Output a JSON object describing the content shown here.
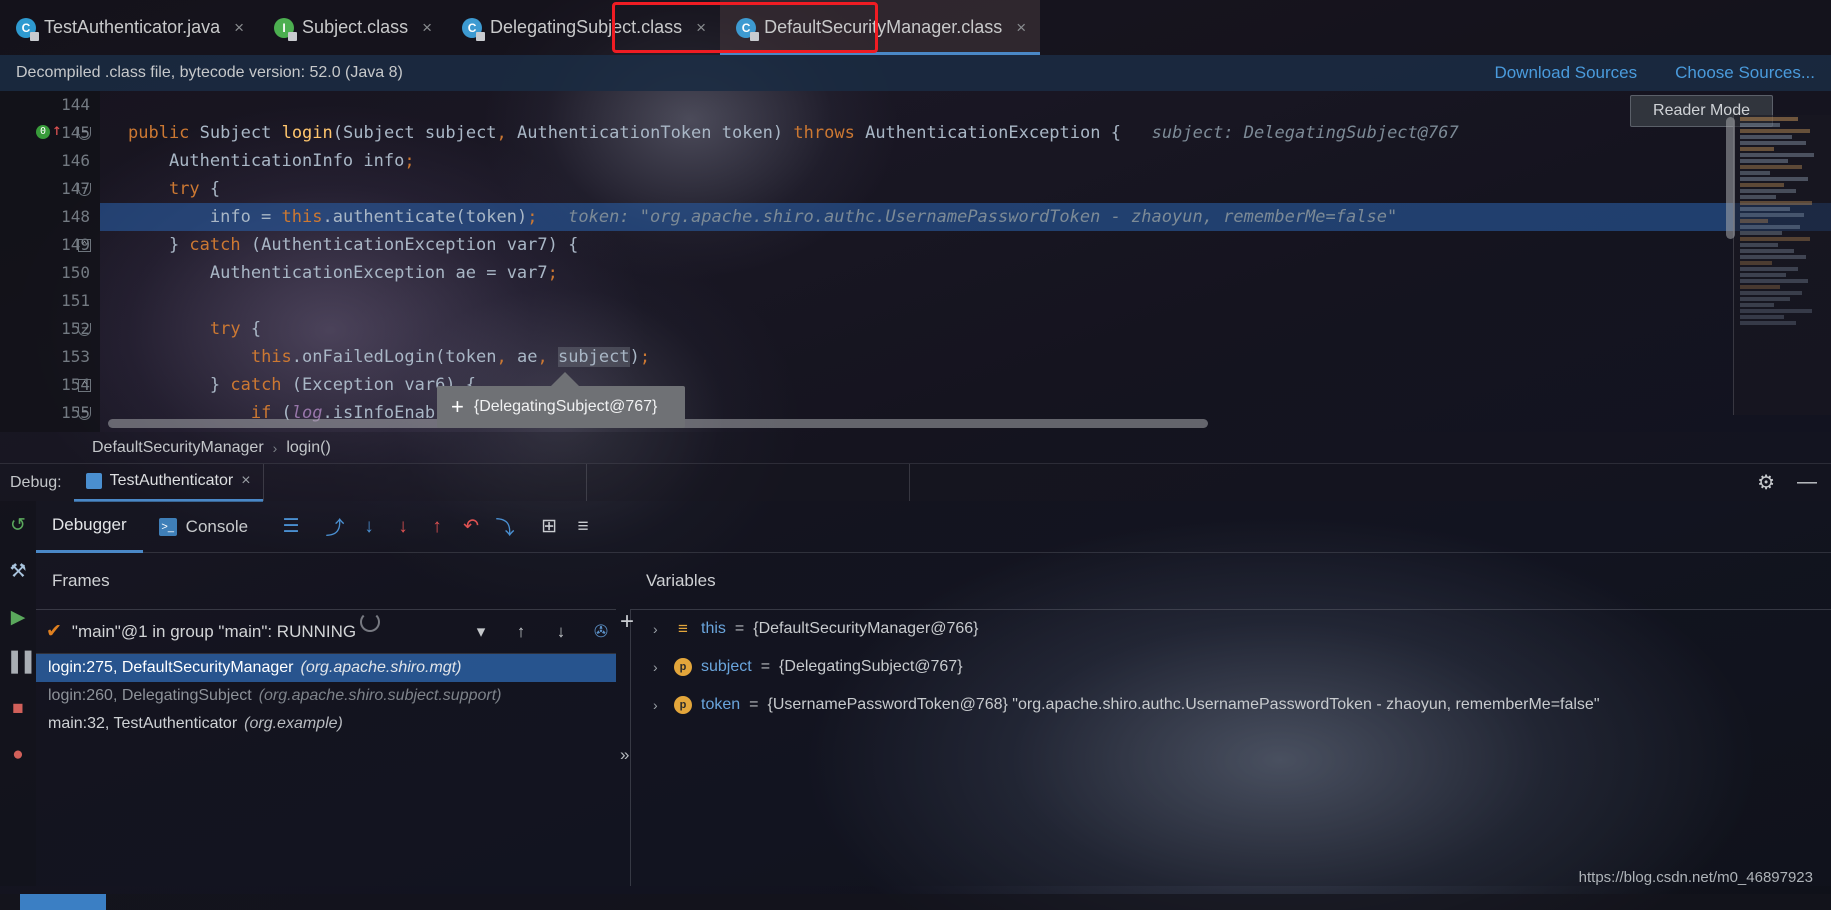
{
  "tabs": [
    {
      "label": "TestAuthenticator.java",
      "icon": "java-class-icon",
      "icon_kind": "green",
      "close": "×",
      "active": false
    },
    {
      "label": "Subject.class",
      "icon": "interface-icon",
      "icon_kind": "iface",
      "close": "×",
      "active": false
    },
    {
      "label": "DelegatingSubject.class",
      "icon": "class-icon",
      "icon_kind": "cls",
      "close": "×",
      "active": false
    },
    {
      "label": "DefaultSecurityManager.class",
      "icon": "class-icon",
      "icon_kind": "cls",
      "close": "×",
      "active": true
    }
  ],
  "notice": {
    "text": "Decompiled .class file, bytecode version: 52.0 (Java 8)",
    "download_sources": "Download Sources",
    "choose_sources": "Choose Sources..."
  },
  "editor": {
    "reader_mode": "Reader Mode",
    "lines": [
      {
        "num": "144",
        "text": ""
      },
      {
        "num": "145",
        "text": "public Subject login(Subject subject, AuthenticationToken token) throws AuthenticationException {",
        "hint": "subject: DelegatingSubject@767"
      },
      {
        "num": "146",
        "text": "    AuthenticationInfo info;"
      },
      {
        "num": "147",
        "text": "    try {"
      },
      {
        "num": "148",
        "text": "        info = this.authenticate(token);",
        "hint": "token: \"org.apache.shiro.authc.UsernamePasswordToken - zhaoyun, rememberMe=false\"",
        "highlight": true
      },
      {
        "num": "149",
        "text": "    } catch (AuthenticationException var7) {"
      },
      {
        "num": "150",
        "text": "        AuthenticationException ae = var7;"
      },
      {
        "num": "151",
        "text": ""
      },
      {
        "num": "152",
        "text": "        try {"
      },
      {
        "num": "153",
        "text": "            this.onFailedLogin(token, ae, subject);"
      },
      {
        "num": "154",
        "text": "        } catch (Exception var6) {"
      },
      {
        "num": "155",
        "text": "            if (log.isInfoEnab"
      }
    ]
  },
  "tooltip": {
    "plus": "+",
    "text": "{DelegatingSubject@767}"
  },
  "breadcrumb": {
    "class": "DefaultSecurityManager",
    "sep": "›",
    "method": "login()"
  },
  "debug_header": {
    "label": "Debug:",
    "config_name": "TestAuthenticator",
    "close": "×",
    "gear": "⚙",
    "minimize": "—"
  },
  "debug_toolbar": {
    "tabs": [
      {
        "label": "Debugger",
        "active": true
      },
      {
        "label": "Console",
        "active": false,
        "icon": "console-icon"
      }
    ],
    "icons": [
      {
        "name": "layout-settings-icon",
        "glyph": "☰",
        "color": "#4a8fd0"
      },
      {
        "name": "step-over-icon",
        "glyph": "⤴",
        "color": "#4a8fd0"
      },
      {
        "name": "step-into-icon",
        "glyph": "↓",
        "color": "#4a8fd0"
      },
      {
        "name": "force-step-into-icon",
        "glyph": "↓",
        "color": "#e05252"
      },
      {
        "name": "step-out-icon",
        "glyph": "↑",
        "color": "#e05252"
      },
      {
        "name": "drop-frame-icon",
        "glyph": "↶",
        "color": "#e05252"
      },
      {
        "name": "run-to-cursor-icon",
        "glyph": "⤵",
        "color": "#4a8fd0"
      },
      {
        "name": "evaluate-expression-icon",
        "glyph": "⊞",
        "color": "#c9ccd0"
      },
      {
        "name": "mute-breakpoints-icon",
        "glyph": "≡",
        "color": "#c9ccd0"
      }
    ]
  },
  "frames": {
    "title": "Frames",
    "thread": "\"main\"@1 in group \"main\": RUNNING",
    "thread_check": "✔",
    "dropdown": "▾",
    "up": "↑",
    "down": "↓",
    "filter": "✇",
    "rows": [
      {
        "text": "login:275, DefaultSecurityManager",
        "pkg": "(org.apache.shiro.mgt)",
        "selected": true
      },
      {
        "text": "login:260, DelegatingSubject",
        "pkg": "(org.apache.shiro.subject.support)",
        "dim": true
      },
      {
        "text": "main:32, TestAuthenticator",
        "pkg": "(org.example)"
      }
    ]
  },
  "variables": {
    "title": "Variables",
    "add": "+",
    "collapse": "»",
    "rows": [
      {
        "chev": "›",
        "kind": "f",
        "icon_glyph": "≡",
        "name": "this",
        "eq": "=",
        "value": "{DefaultSecurityManager@766}"
      },
      {
        "chev": "›",
        "kind": "p",
        "icon_glyph": "p",
        "name": "subject",
        "eq": "=",
        "value": "{DelegatingSubject@767}"
      },
      {
        "chev": "›",
        "kind": "p",
        "icon_glyph": "p",
        "name": "token",
        "eq": "=",
        "value": "{UsernamePasswordToken@768} \"org.apache.shiro.authc.UsernamePasswordToken - zhaoyun, rememberMe=false\""
      }
    ]
  },
  "watermark": "https://blog.csdn.net/m0_46897923",
  "left_rail": [
    {
      "name": "rerun-icon",
      "glyph": "↺",
      "color": "#5aa85c"
    },
    {
      "name": "settings-wrench-icon",
      "glyph": "⚒",
      "color": "#a9c4dd"
    },
    {
      "name": "resume-program-icon",
      "glyph": "▶",
      "color": "#5aa85c"
    },
    {
      "name": "pause-program-icon",
      "glyph": "▐▐",
      "color": "#a9aeb4"
    },
    {
      "name": "stop-icon",
      "glyph": "■",
      "color": "#d2605a"
    },
    {
      "name": "view-breakpoints-icon",
      "glyph": "●",
      "color": "#d2605a"
    }
  ],
  "colors": {
    "accent": "#4a88c7",
    "highlight_border": "#ef1c23",
    "selection": "#2d64aa",
    "keyword": "#cc7832",
    "method": "#ffc66d",
    "field": "#9876aa",
    "hint": "#7c8a96",
    "link": "#4a9bdc"
  }
}
